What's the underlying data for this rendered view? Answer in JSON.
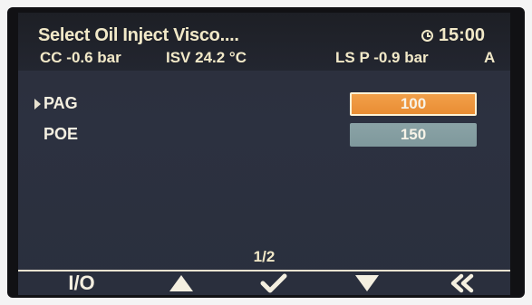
{
  "header": {
    "title": "Select Oil Inject Visco....",
    "time": "15:00"
  },
  "readings": {
    "cc": "CC -0.6 bar",
    "isv": "ISV 24.2 °C",
    "ls": "LS P -0.9 bar",
    "mode": "A"
  },
  "options": [
    {
      "label": "PAG",
      "value": "100",
      "selected": true
    },
    {
      "label": "POE",
      "value": "150",
      "selected": false
    }
  ],
  "page_indicator": "1/2",
  "softkeys": {
    "io_label": "I/O",
    "up_icon": "up-triangle",
    "confirm_icon": "checkmark",
    "down_icon": "down-triangle",
    "back_icon": "double-chevron-left"
  },
  "colors": {
    "selected_value_bg": "#ec9339",
    "value_bg": "#849da1",
    "text": "#f2e9c8",
    "screen_bg": "#2b303d"
  }
}
